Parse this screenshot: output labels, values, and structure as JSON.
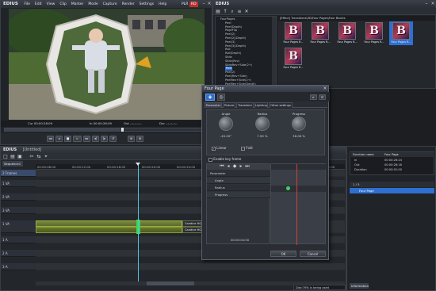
{
  "app": {
    "logo": "EDIUS",
    "badge": "PLR",
    "badge2": "RD"
  },
  "player_menu": [
    "File",
    "Edit",
    "View",
    "Clip",
    "Marker",
    "Mode",
    "Capture",
    "Render",
    "Settings",
    "Help"
  ],
  "player": {
    "cur": "Cur 00:00:28:09",
    "in": "In 00:00:28:09",
    "out": "Out --:--:--:--",
    "dur": "Dur --:--:--:--",
    "transport": [
      "◂◂",
      "◂",
      "■",
      "▸",
      "▸▸",
      "◂|",
      "|▸",
      "↺"
    ]
  },
  "bin": {
    "title": "EDIUS",
    "path": "[Effect] Transitions\\3D\\Four Pages\\Four Blocks",
    "folder_tree": [
      "FourPages",
      "Peel",
      "Peel(Depth)",
      "PageFlip",
      "Peel(2)",
      "Peel(2)(Depth)",
      "Peel(3)",
      "Peel(3)(Depth)",
      "Roll",
      "Roll(Depth)",
      "Slide",
      "Slide(Rev)",
      "SlideRev+Side(2+)",
      "Peel",
      "Peel(2)",
      "Peel(Rev+Side)",
      "PeelRev+Side(2+)",
      "PeelRev+Side(Depth)"
    ],
    "items": [
      {
        "glyph": "B",
        "label": "Four Pages R..."
      },
      {
        "glyph": "B",
        "label": "Four Pages R..."
      },
      {
        "glyph": "B",
        "label": "Four Pages R..."
      },
      {
        "glyph": "B",
        "label": "Four Pages R..."
      },
      {
        "glyph": "B",
        "label": "Four Pages R..."
      },
      {
        "glyph": "B",
        "label": "Four Pages R..."
      }
    ]
  },
  "timeline": {
    "title": "EDIUS",
    "project": "[Untitled]",
    "sequence": "Sequence1",
    "ruler": [
      "00:00:08:00",
      "00:00:12:00",
      "00:00:16:00",
      "00:00:20:00",
      "00:00:24:00",
      "00:00:28:00",
      "00:00:32:00",
      "00:00:36:00",
      "00:00:40:00"
    ],
    "tracks": [
      "2 Frames",
      "1 VA",
      "2 VA",
      "3 VA",
      "1 VA",
      "1 A",
      "2 A",
      "3 A"
    ],
    "clip1": "Candice HQ",
    "clip2": "Candice HQ Orig"
  },
  "dialog": {
    "title": "Four Page",
    "tabs": [
      "Parameter",
      "Picture",
      "Transform",
      "Lighting",
      "Other settings"
    ],
    "knobs": [
      {
        "label": "Angle",
        "value": "-45.00°"
      },
      {
        "label": "Radius",
        "value": "7.90 %"
      },
      {
        "label": "Progress",
        "value": "36.08 %"
      }
    ],
    "check_linear": "Linear",
    "check_fold": "Fold",
    "enable_keyframe": "Enable key frame",
    "rows": [
      "Parameter",
      "Angle",
      "Radius",
      "Progress"
    ],
    "ok": "OK",
    "cancel": "Cancel",
    "timecode": "00:00:04:00"
  },
  "info": {
    "headers": [
      "Function name",
      "Four Page"
    ],
    "rows": [
      [
        "In",
        "00:00:26:24"
      ],
      [
        "Out",
        "00:00:28:16"
      ],
      [
        "Duration",
        "00:00:01:00"
      ]
    ],
    "list_header": "1 / 5",
    "item": "Four Page",
    "tab": "Information"
  },
  "status": "Disk:76% is being used",
  "colors": {
    "accent": "#3a7bd5",
    "clip_green": "#6a7a2a",
    "marker": "#3fd45a"
  }
}
